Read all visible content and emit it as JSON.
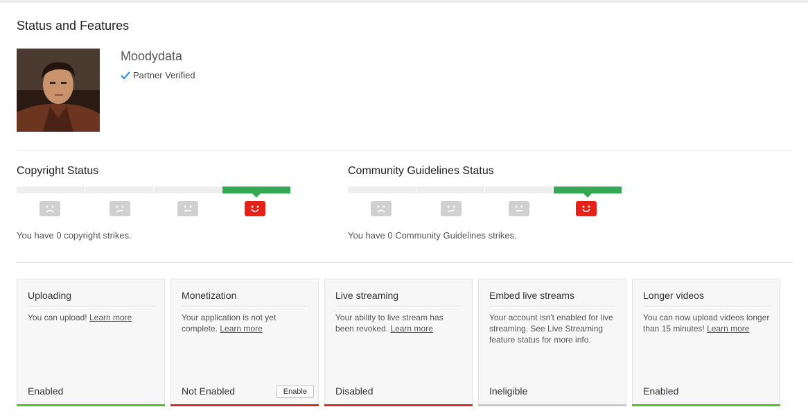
{
  "page": {
    "title": "Status and Features"
  },
  "channel": {
    "name": "Moodydata",
    "verified_label": "Partner Verified",
    "verified_icon": "check-icon",
    "accent_color": "#1e88e5"
  },
  "copyright": {
    "title": "Copyright Status",
    "strikes_text": "You have 0 copyright strikes.",
    "strike_count": 0,
    "active_segment": 4,
    "faces": [
      "sad-face-icon",
      "neutral-face-icon",
      "neutral-face-icon",
      "happy-face-icon"
    ]
  },
  "community": {
    "title": "Community Guidelines Status",
    "strikes_text": "You have 0 Community Guidelines strikes.",
    "strike_count": 0,
    "active_segment": 4,
    "faces": [
      "sad-face-icon",
      "neutral-face-icon",
      "neutral-face-icon",
      "happy-face-icon"
    ]
  },
  "colors": {
    "good": "#35a852",
    "bad": "#e62117",
    "enabled": "#55c32a",
    "not_enabled": "#d92b2b",
    "disabled": "#d92b2b",
    "ineligible": "#c8c8c8"
  },
  "features": [
    {
      "title": "Uploading",
      "desc": "You can upload!",
      "link": "Learn more",
      "status": "Enabled",
      "status_color": "#55c32a"
    },
    {
      "title": "Monetization",
      "desc": "Your application is not yet complete.",
      "link": "Learn more",
      "status": "Not Enabled",
      "status_color": "#d92b2b",
      "button": "Enable"
    },
    {
      "title": "Live streaming",
      "desc": "Your ability to live stream has been revoked.",
      "link": "Learn more",
      "status": "Disabled",
      "status_color": "#d92b2b"
    },
    {
      "title": "Embed live streams",
      "desc": "Your account isn't enabled for live streaming. See Live Streaming feature status for more info.",
      "link": "",
      "status": "Ineligible",
      "status_color": "#c8c8c8"
    },
    {
      "title": "Longer videos",
      "desc": "You can now upload videos longer than 15 minutes!",
      "link": "Learn more",
      "status": "Enabled",
      "status_color": "#55c32a"
    }
  ]
}
